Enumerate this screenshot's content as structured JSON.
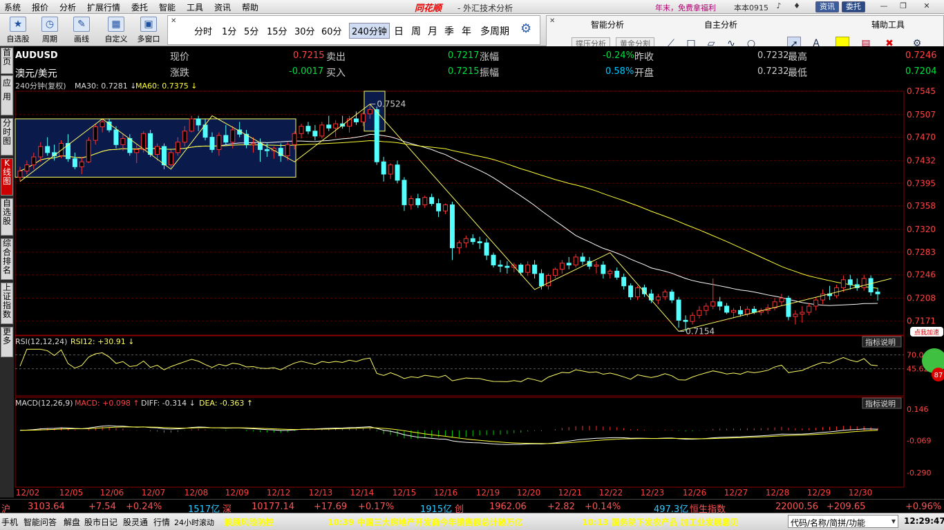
{
  "menu": {
    "items": [
      "系统",
      "报价",
      "分析",
      "扩展行情",
      "委托",
      "智能",
      "工具",
      "资讯",
      "帮助"
    ],
    "brand": "同花顺",
    "brand_sub": "- 外汇技术分析",
    "promo": "年末，免费拿福利",
    "version": "本本0915",
    "btn_info": "资讯",
    "btn_trade": "委托"
  },
  "toolbar": {
    "buttons": [
      "自选股",
      "周期",
      "画线",
      "自定义",
      "多窗口"
    ],
    "periods": [
      "分时",
      "1分",
      "5分",
      "15分",
      "30分",
      "60分",
      "240分钟",
      "日",
      "周",
      "月",
      "季",
      "年",
      "多周期"
    ],
    "selected_period": "240分钟"
  },
  "analysis": {
    "smart_title": "智能分析",
    "self_title": "自主分析",
    "aux_title": "辅助工具",
    "btn_pressure": "撑压分析",
    "btn_golden": "黄金分割"
  },
  "sidebar": [
    "首页",
    "应用",
    "分时图",
    "K线图",
    "自选股",
    "综合排名",
    "上证指数",
    "更多"
  ],
  "quote": {
    "symbol": "AUDUSD",
    "name": "澳元/美元",
    "row1": [
      {
        "label": "现价",
        "value": "0.7215"
      },
      {
        "label": "卖出",
        "value": "0.7217"
      },
      {
        "label": "涨幅",
        "value": "-0.24%"
      },
      {
        "label": "昨收",
        "value": "0.7232"
      },
      {
        "label": "最高",
        "value": "0.7246"
      }
    ],
    "row2": [
      {
        "label": "涨跌",
        "value": "-0.0017"
      },
      {
        "label": "买入",
        "value": "0.7215"
      },
      {
        "label": "振幅",
        "value": "0.58%"
      },
      {
        "label": "开盘",
        "value": "0.7232"
      },
      {
        "label": "最低",
        "value": "0.7204"
      }
    ],
    "ma_info": "240分钟(复权)",
    "ma30": "MA30: 0.7281",
    "ma60": "MA60: 0.7375"
  },
  "chart_data": {
    "type": "candlestick",
    "price_axis": {
      "ticks": [
        0.7545,
        0.7507,
        0.747,
        0.7432,
        0.7395,
        0.7358,
        0.732,
        0.7283,
        0.7246,
        0.7208,
        0.7171
      ],
      "labels": [
        "0.7545",
        "0.7507",
        "0.7470",
        "0.7432",
        "0.7395",
        "0.7358",
        "0.7320",
        "0.7283",
        "0.7246",
        "0.7208",
        "0.7171"
      ]
    },
    "dates": [
      "12/02",
      "12/05",
      "12/06",
      "12/07",
      "12/08",
      "12/09",
      "12/12",
      "12/13",
      "12/14",
      "12/15",
      "12/16",
      "12/19",
      "12/20",
      "12/21",
      "12/22",
      "12/23",
      "12/26",
      "12/27",
      "12/28",
      "12/29",
      "12/30"
    ],
    "high_label": "0.7524",
    "low_label": "0.7154",
    "ohlc": [
      [
        0.7405,
        0.7422,
        0.7398,
        0.7415
      ],
      [
        0.7415,
        0.7432,
        0.741,
        0.7425
      ],
      [
        0.7425,
        0.7445,
        0.7418,
        0.7438
      ],
      [
        0.7438,
        0.7462,
        0.743,
        0.7455
      ],
      [
        0.7455,
        0.747,
        0.744,
        0.7445
      ],
      [
        0.7445,
        0.7458,
        0.7432,
        0.744
      ],
      [
        0.744,
        0.7465,
        0.7436,
        0.746
      ],
      [
        0.746,
        0.7475,
        0.743,
        0.7435
      ],
      [
        0.7435,
        0.7445,
        0.7418,
        0.7422
      ],
      [
        0.7422,
        0.7438,
        0.741,
        0.743
      ],
      [
        0.743,
        0.747,
        0.7428,
        0.7465
      ],
      [
        0.7465,
        0.7492,
        0.7458,
        0.7487
      ],
      [
        0.7487,
        0.75,
        0.7478,
        0.7495
      ],
      [
        0.7495,
        0.75,
        0.7478,
        0.7482
      ],
      [
        0.7482,
        0.7488,
        0.7452,
        0.7458
      ],
      [
        0.7458,
        0.7475,
        0.7448,
        0.7468
      ],
      [
        0.7468,
        0.7475,
        0.744,
        0.7445
      ],
      [
        0.7445,
        0.7458,
        0.7428,
        0.745
      ],
      [
        0.745,
        0.748,
        0.7445,
        0.7476
      ],
      [
        0.7476,
        0.7482,
        0.7438,
        0.7442
      ],
      [
        0.7442,
        0.746,
        0.7432,
        0.7455
      ],
      [
        0.7455,
        0.746,
        0.7418,
        0.7425
      ],
      [
        0.7425,
        0.745,
        0.742,
        0.7445
      ],
      [
        0.7445,
        0.747,
        0.744,
        0.7462
      ],
      [
        0.7462,
        0.7488,
        0.7455,
        0.748
      ],
      [
        0.748,
        0.7505,
        0.7478,
        0.75
      ],
      [
        0.75,
        0.7505,
        0.748,
        0.749
      ],
      [
        0.749,
        0.75,
        0.7465,
        0.747
      ],
      [
        0.747,
        0.7478,
        0.7445,
        0.745
      ],
      [
        0.745,
        0.7478,
        0.744,
        0.7473
      ],
      [
        0.7473,
        0.749,
        0.7458,
        0.7462
      ],
      [
        0.7462,
        0.7488,
        0.7452,
        0.7482
      ],
      [
        0.7482,
        0.7495,
        0.747,
        0.7475
      ],
      [
        0.7475,
        0.7482,
        0.7452,
        0.7458
      ],
      [
        0.7458,
        0.747,
        0.7445,
        0.746
      ],
      [
        0.746,
        0.7468,
        0.743,
        0.745
      ],
      [
        0.745,
        0.746,
        0.7438,
        0.7448
      ],
      [
        0.7448,
        0.7455,
        0.7435,
        0.7452
      ],
      [
        0.7452,
        0.746,
        0.743,
        0.744
      ],
      [
        0.744,
        0.7462,
        0.7432,
        0.7458
      ],
      [
        0.7458,
        0.748,
        0.745,
        0.7476
      ],
      [
        0.7476,
        0.7492,
        0.7468,
        0.7488
      ],
      [
        0.7488,
        0.7495,
        0.7475,
        0.748
      ],
      [
        0.748,
        0.749,
        0.7465,
        0.7472
      ],
      [
        0.7472,
        0.7495,
        0.7468,
        0.749
      ],
      [
        0.749,
        0.7505,
        0.748,
        0.7485
      ],
      [
        0.7485,
        0.7498,
        0.747,
        0.7492
      ],
      [
        0.7492,
        0.7505,
        0.7484,
        0.7488
      ],
      [
        0.7488,
        0.7505,
        0.7478,
        0.75
      ],
      [
        0.75,
        0.7512,
        0.749,
        0.7495
      ],
      [
        0.7495,
        0.7512,
        0.7488,
        0.7508
      ],
      [
        0.7508,
        0.7524,
        0.75,
        0.7515
      ],
      [
        0.7515,
        0.752,
        0.7425,
        0.743
      ],
      [
        0.743,
        0.7438,
        0.7398,
        0.741
      ],
      [
        0.741,
        0.7428,
        0.7402,
        0.7425
      ],
      [
        0.7425,
        0.7432,
        0.7395,
        0.74
      ],
      [
        0.74,
        0.7405,
        0.735,
        0.736
      ],
      [
        0.736,
        0.7375,
        0.7352,
        0.737
      ],
      [
        0.737,
        0.7378,
        0.7355,
        0.736
      ],
      [
        0.736,
        0.7375,
        0.7355,
        0.7372
      ],
      [
        0.7372,
        0.7378,
        0.7358,
        0.7362
      ],
      [
        0.7362,
        0.737,
        0.734,
        0.735
      ],
      [
        0.735,
        0.7362,
        0.7345,
        0.736
      ],
      [
        0.736,
        0.7365,
        0.727,
        0.729
      ],
      [
        0.729,
        0.7302,
        0.728,
        0.7298
      ],
      [
        0.7298,
        0.731,
        0.729,
        0.7305
      ],
      [
        0.7305,
        0.7312,
        0.7295,
        0.73
      ],
      [
        0.73,
        0.7308,
        0.7288,
        0.7298
      ],
      [
        0.7298,
        0.7305,
        0.727,
        0.7278
      ],
      [
        0.7278,
        0.7282,
        0.7258,
        0.7262
      ],
      [
        0.7262,
        0.727,
        0.725,
        0.726
      ],
      [
        0.726,
        0.7268,
        0.7248,
        0.7258
      ],
      [
        0.7258,
        0.7266,
        0.725,
        0.7262
      ],
      [
        0.7262,
        0.7265,
        0.7245,
        0.725
      ],
      [
        0.725,
        0.7268,
        0.7244,
        0.7262
      ],
      [
        0.7262,
        0.727,
        0.724,
        0.7248
      ],
      [
        0.7248,
        0.7255,
        0.7222,
        0.7228
      ],
      [
        0.7228,
        0.7248,
        0.7222,
        0.7245
      ],
      [
        0.7245,
        0.7258,
        0.724,
        0.7255
      ],
      [
        0.7255,
        0.727,
        0.7248,
        0.7265
      ],
      [
        0.7265,
        0.7275,
        0.7255,
        0.7262
      ],
      [
        0.7262,
        0.728,
        0.7258,
        0.7275
      ],
      [
        0.7275,
        0.7282,
        0.7262,
        0.7268
      ],
      [
        0.7268,
        0.7275,
        0.7255,
        0.726
      ],
      [
        0.726,
        0.7268,
        0.7248,
        0.7262
      ],
      [
        0.7262,
        0.7268,
        0.724,
        0.7248
      ],
      [
        0.7248,
        0.7255,
        0.724,
        0.7252
      ],
      [
        0.7252,
        0.7258,
        0.7238,
        0.7242
      ],
      [
        0.7242,
        0.7248,
        0.7222,
        0.7228
      ],
      [
        0.7228,
        0.7232,
        0.7205,
        0.721
      ],
      [
        0.721,
        0.7228,
        0.7205,
        0.7225
      ],
      [
        0.7225,
        0.723,
        0.721,
        0.7215
      ],
      [
        0.7215,
        0.7222,
        0.72,
        0.7205
      ],
      [
        0.7205,
        0.7215,
        0.7198,
        0.721
      ],
      [
        0.721,
        0.7222,
        0.7205,
        0.7218
      ],
      [
        0.7218,
        0.7222,
        0.72,
        0.7205
      ],
      [
        0.7205,
        0.721,
        0.716,
        0.7172
      ],
      [
        0.7172,
        0.718,
        0.7154,
        0.717
      ],
      [
        0.717,
        0.7185,
        0.7165,
        0.718
      ],
      [
        0.718,
        0.7195,
        0.7175,
        0.7188
      ],
      [
        0.7188,
        0.72,
        0.718,
        0.7195
      ],
      [
        0.7195,
        0.724,
        0.719,
        0.7202
      ],
      [
        0.7202,
        0.721,
        0.7188,
        0.7195
      ],
      [
        0.7195,
        0.72,
        0.7182,
        0.7185
      ],
      [
        0.7185,
        0.7192,
        0.7175,
        0.7188
      ],
      [
        0.7188,
        0.7195,
        0.7178,
        0.7182
      ],
      [
        0.7182,
        0.7195,
        0.7178,
        0.719
      ],
      [
        0.719,
        0.7195,
        0.7182,
        0.7185
      ],
      [
        0.7185,
        0.7192,
        0.718,
        0.7188
      ],
      [
        0.7188,
        0.7198,
        0.7182,
        0.7192
      ],
      [
        0.7192,
        0.7208,
        0.7188,
        0.7202
      ],
      [
        0.7202,
        0.7215,
        0.7195,
        0.7208
      ],
      [
        0.7208,
        0.7212,
        0.7172,
        0.7178
      ],
      [
        0.7178,
        0.7188,
        0.7165,
        0.7182
      ],
      [
        0.7182,
        0.7195,
        0.7168,
        0.7185
      ],
      [
        0.7185,
        0.72,
        0.718,
        0.7195
      ],
      [
        0.7195,
        0.721,
        0.7188,
        0.7205
      ],
      [
        0.7205,
        0.7222,
        0.7198,
        0.7215
      ],
      [
        0.7215,
        0.7228,
        0.7205,
        0.7212
      ],
      [
        0.7212,
        0.723,
        0.7208,
        0.7225
      ],
      [
        0.7225,
        0.7245,
        0.7218,
        0.7238
      ],
      [
        0.7238,
        0.7246,
        0.7222,
        0.723
      ],
      [
        0.723,
        0.724,
        0.722,
        0.7225
      ],
      [
        0.7225,
        0.7246,
        0.722,
        0.724
      ],
      [
        0.724,
        0.7245,
        0.7212,
        0.7218
      ],
      [
        0.7218,
        0.7225,
        0.7204,
        0.7215
      ]
    ],
    "rsi": {
      "label": "RSI(12,12,24)",
      "value_label": "RSI12: +30.91",
      "axis": [
        "70.0",
        "45.62"
      ],
      "explain": "指标说明"
    },
    "macd": {
      "label": "MACD(12,26,9)",
      "macd": "MACD: +0.098",
      "diff": "DIFF: -0.314",
      "dea": "DEA: -0.363",
      "axis": [
        "0.146",
        "-0.069",
        "-0.290"
      ],
      "explain": "指标说明"
    },
    "badge_value": "87",
    "badge_text": "点我加速"
  },
  "ticker": {
    "sh_label": "沪",
    "sh_value": "3103.64",
    "sh_chg": "+7.54",
    "sh_pct": "+0.24%",
    "sh_amt": "1517亿",
    "sz_label": "深",
    "sz_value": "10177.14",
    "sz_chg": "+17.69",
    "sz_pct": "+0.17%",
    "sz_amt": "1915亿",
    "cy_label": "创",
    "cy_value": "1962.06",
    "cy_chg": "+2.82",
    "cy_pct": "+0.14%",
    "cy_amt": "497.3亿",
    "hs_label": "恒生指数",
    "hs_value": "22000.56",
    "hs_chg": "+209.65",
    "hs_pct": "+0.96%"
  },
  "statusbar": {
    "items": [
      "手机",
      "智能问答",
      "解盘",
      "股市日记",
      "股灵通",
      "行情",
      "24小时滚动"
    ],
    "news1": "兼顾风险防控",
    "news2": "10:39 中国三大房地产开发商今年销售额总计破万亿",
    "news3": "10:13 国务院下发农产品 加工业发展意见",
    "search_placeholder": "代码/名称/简拼/功能",
    "time": "12:29:47"
  }
}
